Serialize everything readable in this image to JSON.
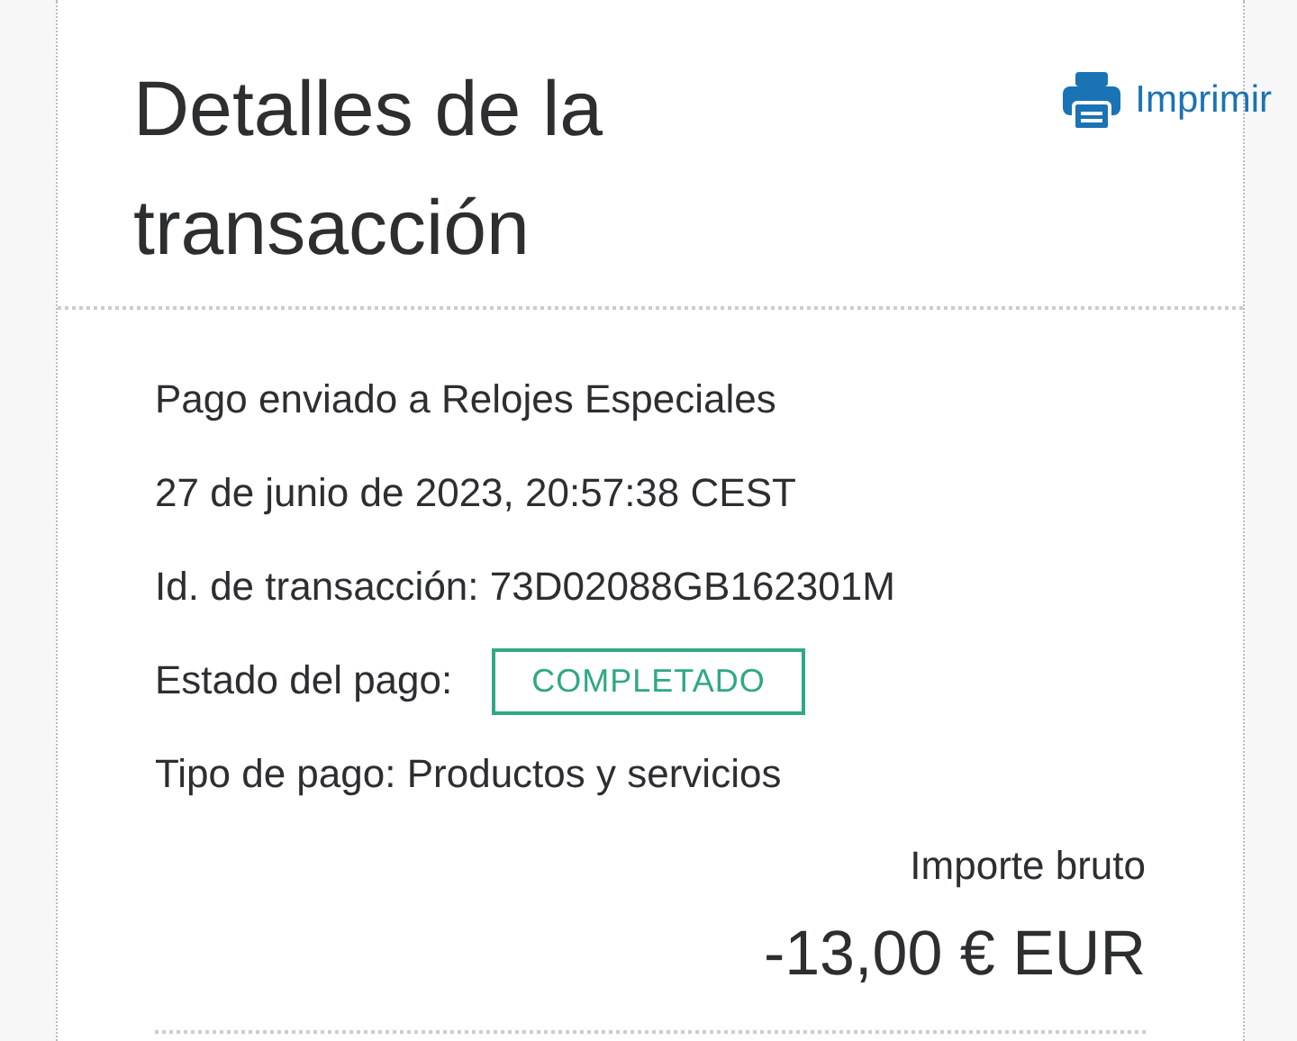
{
  "header": {
    "title": "Detalles de la transacción",
    "print_link": "Imprimir"
  },
  "details": [
    {
      "kind": "text",
      "text": "Pago enviado a Relojes Especiales"
    },
    {
      "kind": "text",
      "text": "27 de junio de 2023, 20:57:38 CEST"
    },
    {
      "kind": "text",
      "text": "Id. de transacción: 73D02088GB162301M"
    },
    {
      "kind": "status",
      "label": "Estado del pago:",
      "status": "COMPLETADO",
      "color": "#2ea886"
    },
    {
      "kind": "text",
      "text": "Tipo de pago: Productos y servicios"
    }
  ],
  "amount": {
    "label": "Importe bruto",
    "value": "-13,00 € EUR"
  }
}
